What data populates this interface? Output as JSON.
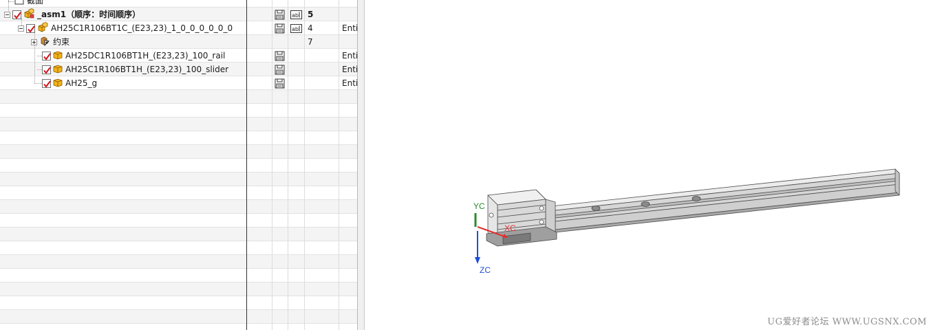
{
  "navigator": {
    "rows": [
      {
        "name": "截面"
      },
      {
        "name": "_asm1（顺序：时间顺序）",
        "count": "5"
      },
      {
        "name": "AH25C1R106BT1C_(E23,23)_1_0_0_0_0_0_0",
        "count": "4",
        "ref_set": "Enti"
      },
      {
        "name": "约束",
        "count": "7"
      },
      {
        "name": "AH25DC1R106BT1H_(E23,23)_100_rail",
        "ref_set": "Enti"
      },
      {
        "name": "AH25C1R106BT1H_(E23,23)_100_slider",
        "ref_set": "Enti"
      },
      {
        "name": "AH25_g",
        "ref_set": "Enti"
      }
    ]
  },
  "graphics": {
    "axes": {
      "x": "XC",
      "y": "YC",
      "z": "ZC"
    },
    "colors": {
      "x_axis": "#e03030",
      "y_axis": "#2a8a2a",
      "z_axis": "#1e4fd8",
      "model_body": "#d9d9d9",
      "model_edge": "#4a4a4a"
    },
    "watermark": "UG爱好者论坛 WWW.UGSNX.COM"
  }
}
